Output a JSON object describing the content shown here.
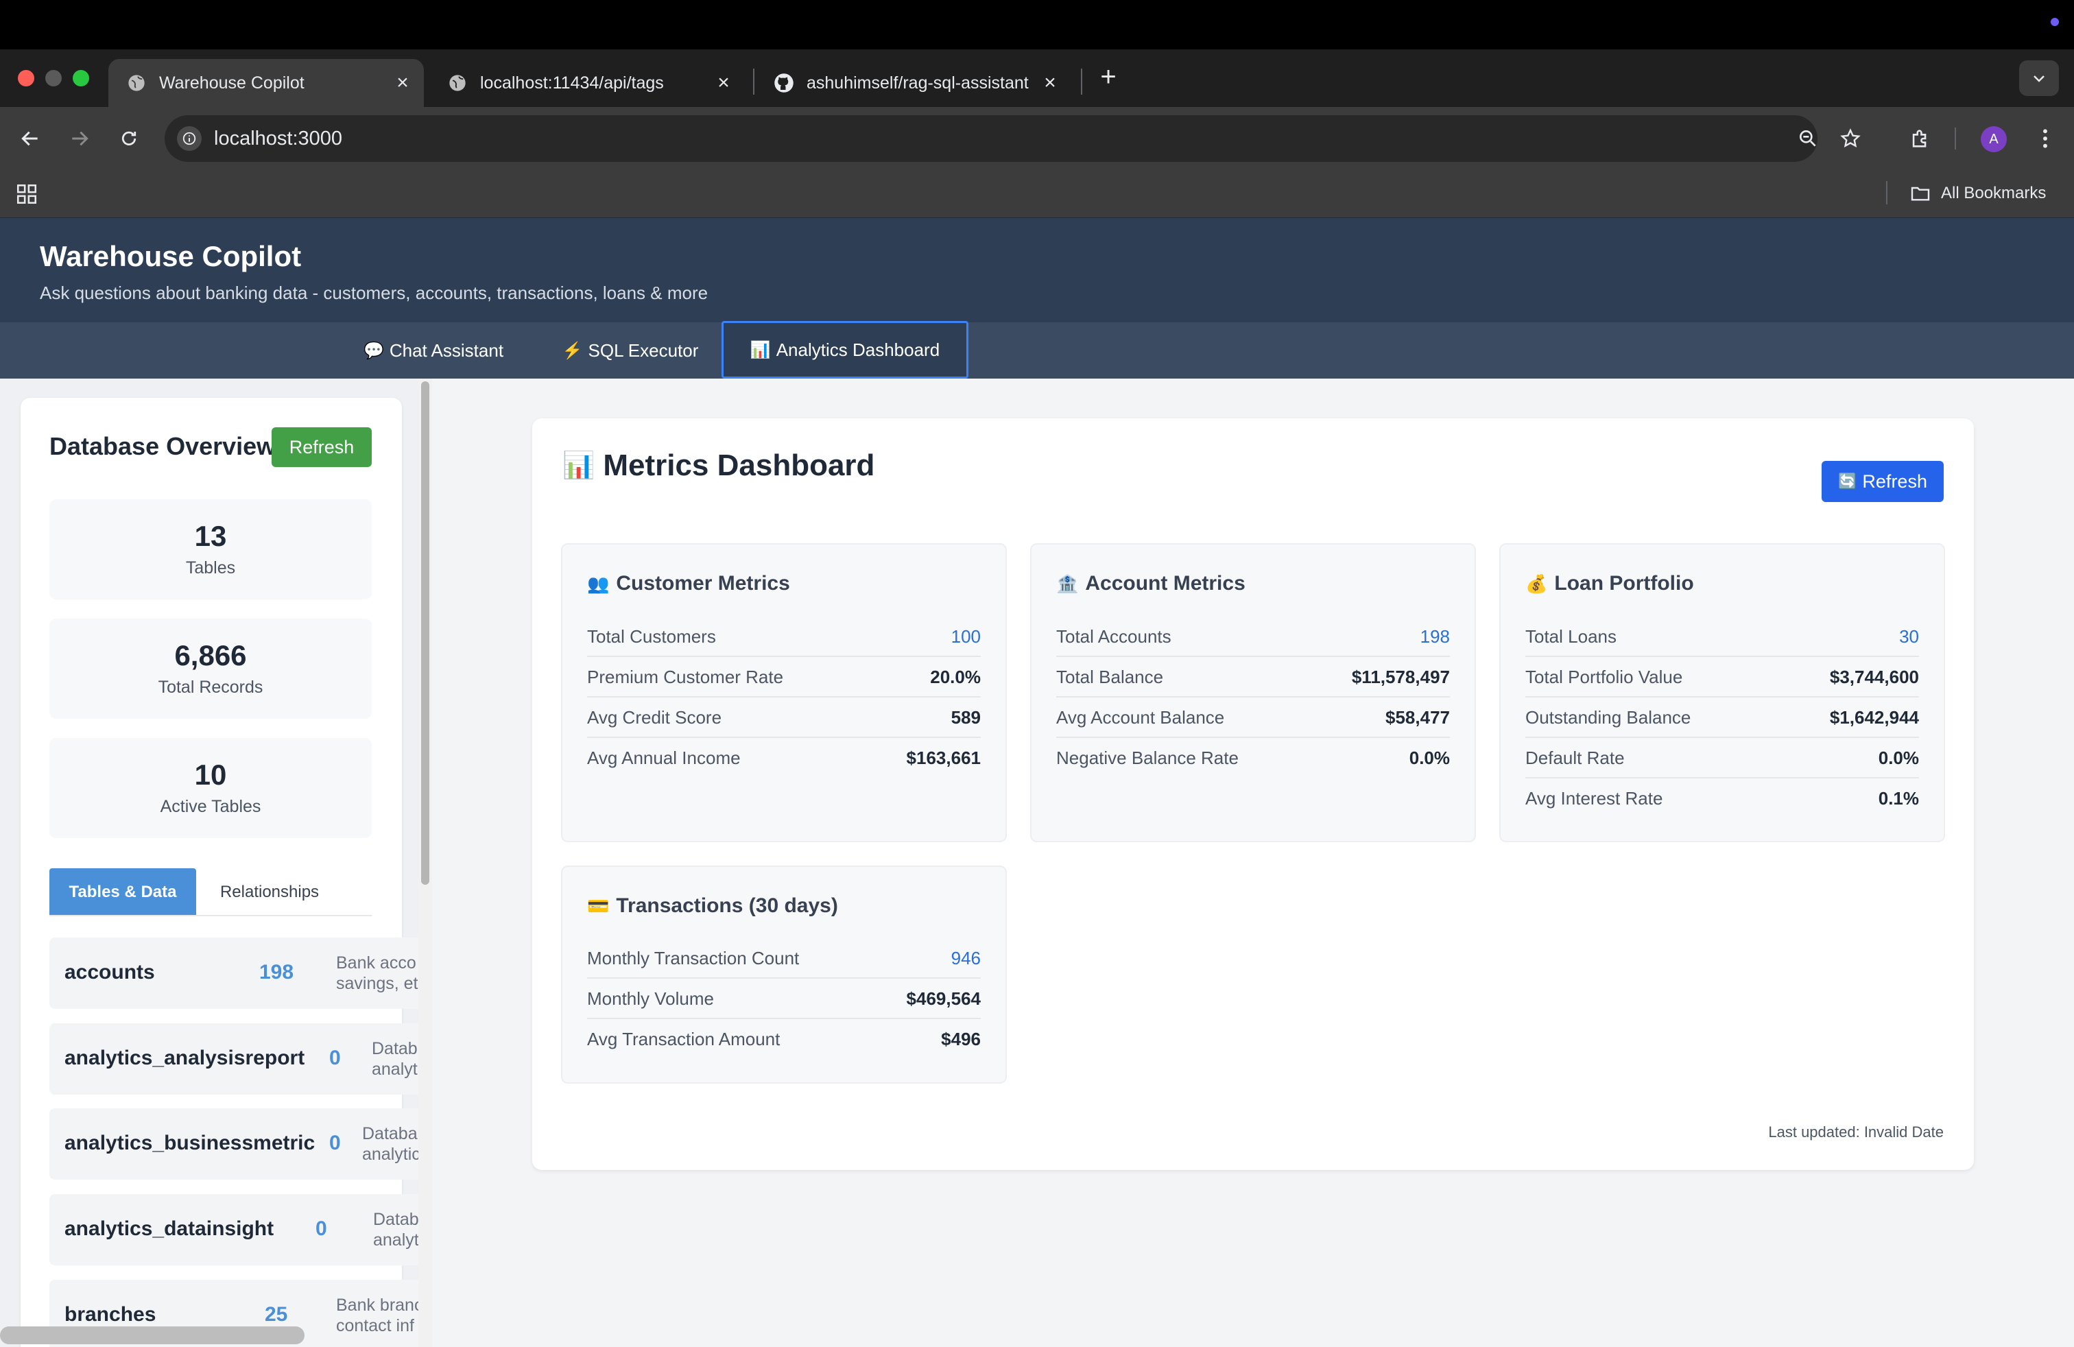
{
  "browser": {
    "tabs": [
      {
        "title": "Warehouse Copilot"
      },
      {
        "title": "localhost:11434/api/tags"
      },
      {
        "title": "ashuhimself/rag-sql-assistant"
      }
    ],
    "url": "localhost:3000",
    "avatar_letter": "A",
    "bookmarks_label": "All Bookmarks"
  },
  "app": {
    "title": "Warehouse Copilot",
    "subtitle": "Ask questions about banking data - customers, accounts, transactions, loans & more",
    "tabs": [
      {
        "icon": "💬",
        "label": "Chat Assistant"
      },
      {
        "icon": "⚡",
        "label": "SQL Executor"
      },
      {
        "icon": "📊",
        "label": "Analytics Dashboard"
      }
    ]
  },
  "sidebar": {
    "title": "Database Overview",
    "refresh_label": "Refresh",
    "stats": [
      {
        "value": "13",
        "label": "Tables"
      },
      {
        "value": "6,866",
        "label": "Total Records"
      },
      {
        "value": "10",
        "label": "Active Tables"
      }
    ],
    "tabs": [
      "Tables & Data",
      "Relationships"
    ],
    "tables": [
      {
        "name": "accounts",
        "count": "198",
        "desc": "Bank acco savings, et"
      },
      {
        "name": "analytics_analysisreport",
        "count": "0",
        "desc": "Datab analyt"
      },
      {
        "name": "analytics_businessmetric",
        "count": "0",
        "desc": "Databa analytic"
      },
      {
        "name": "analytics_datainsight",
        "count": "0",
        "desc": "Datab analyt"
      },
      {
        "name": "branches",
        "count": "25",
        "desc": "Bank branc contact inf"
      }
    ]
  },
  "dashboard": {
    "icon": "📊",
    "title": "Metrics Dashboard",
    "refresh_icon": "🔄",
    "refresh_label": "Refresh",
    "cards": [
      {
        "icon": "👥",
        "title": "Customer Metrics",
        "rows": [
          {
            "label": "Total Customers",
            "value": "100"
          },
          {
            "label": "Premium Customer Rate",
            "value": "20.0%"
          },
          {
            "label": "Avg Credit Score",
            "value": "589"
          },
          {
            "label": "Avg Annual Income",
            "value": "$163,661"
          }
        ]
      },
      {
        "icon": "🏦",
        "title": "Account Metrics",
        "rows": [
          {
            "label": "Total Accounts",
            "value": "198"
          },
          {
            "label": "Total Balance",
            "value": "$11,578,497"
          },
          {
            "label": "Avg Account Balance",
            "value": "$58,477"
          },
          {
            "label": "Negative Balance Rate",
            "value": "0.0%"
          }
        ]
      },
      {
        "icon": "💰",
        "title": "Loan Portfolio",
        "rows": [
          {
            "label": "Total Loans",
            "value": "30"
          },
          {
            "label": "Total Portfolio Value",
            "value": "$3,744,600"
          },
          {
            "label": "Outstanding Balance",
            "value": "$1,642,944"
          },
          {
            "label": "Default Rate",
            "value": "0.0%"
          },
          {
            "label": "Avg Interest Rate",
            "value": "0.1%"
          }
        ]
      },
      {
        "icon": "💳",
        "title": "Transactions (30 days)",
        "rows": [
          {
            "label": "Monthly Transaction Count",
            "value": "946"
          },
          {
            "label": "Monthly Volume",
            "value": "$469,564"
          },
          {
            "label": "Avg Transaction Amount",
            "value": "$496"
          }
        ]
      }
    ],
    "last_updated": "Last updated: Invalid Date"
  },
  "colors": {
    "header_bg": "#2e3e54",
    "accent_blue": "#2563eb",
    "refresh_green": "#43a047",
    "count_blue": "#4a90d9"
  }
}
